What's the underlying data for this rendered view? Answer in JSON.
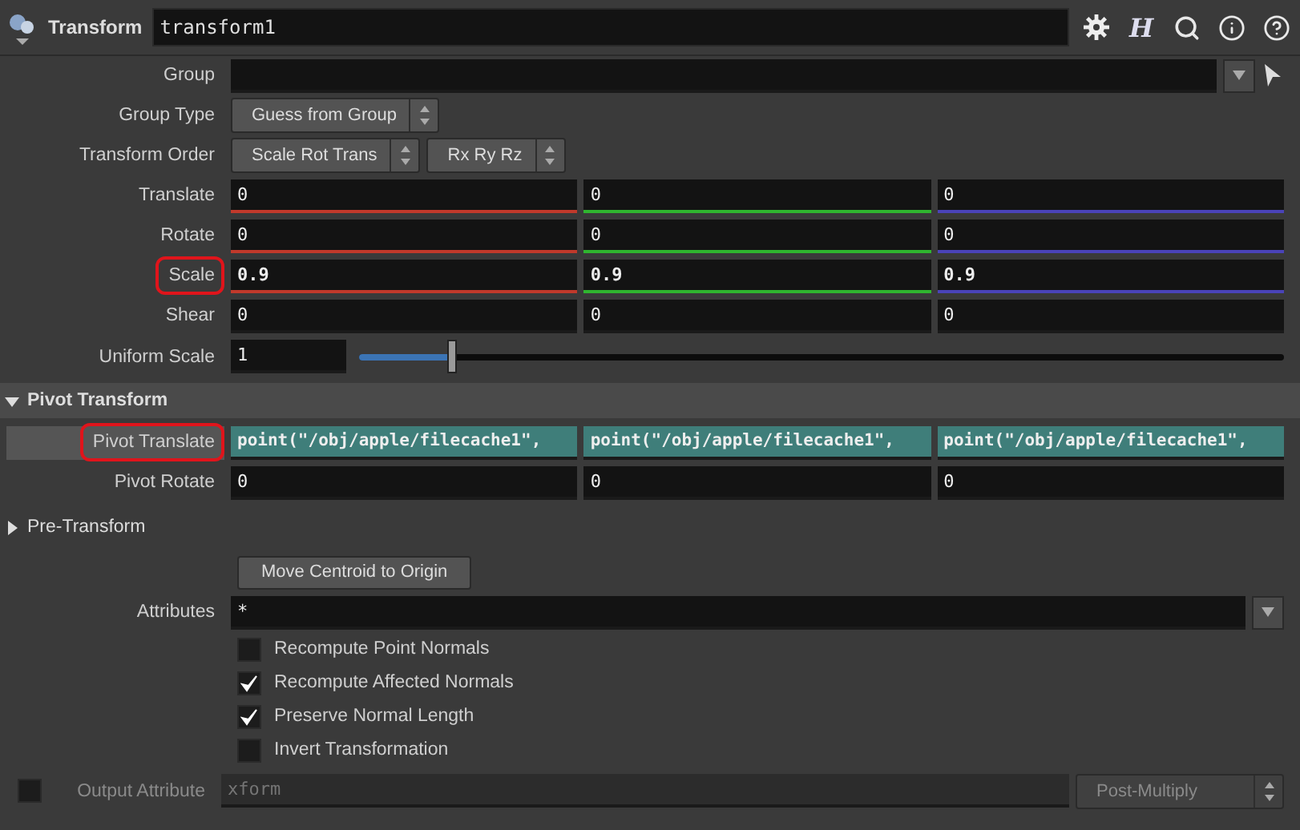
{
  "header": {
    "node_type": "Transform",
    "node_name": "transform1",
    "tools": [
      {
        "kind": "gear"
      },
      {
        "kind": "text",
        "label": "H"
      },
      {
        "kind": "search"
      },
      {
        "kind": "info"
      },
      {
        "kind": "help"
      }
    ]
  },
  "params": [
    {
      "kind": "string",
      "label": "Group",
      "circled": false,
      "hovered": false
    },
    {
      "kind": "menu",
      "label": "Group Type",
      "menus": [
        "Guess from Group"
      ],
      "circled": false,
      "hovered": false
    },
    {
      "kind": "menu",
      "label": "Transform Order",
      "menus": [
        "Scale Rot Trans",
        "Rx Ry Rz"
      ],
      "circled": false,
      "hovered": false
    },
    {
      "kind": "vector",
      "label": "Translate",
      "values": [
        "0",
        "0",
        "0"
      ],
      "modified": false,
      "expression": false,
      "underline": true,
      "circled": false,
      "hovered": false
    },
    {
      "kind": "vector",
      "label": "Rotate",
      "values": [
        "0",
        "0",
        "0"
      ],
      "modified": false,
      "expression": false,
      "underline": true,
      "circled": false,
      "hovered": false
    },
    {
      "kind": "vector",
      "label": "Scale",
      "values": [
        "0.9",
        "0.9",
        "0.9"
      ],
      "modified": true,
      "expression": false,
      "underline": true,
      "circled": true,
      "hovered": false
    },
    {
      "kind": "vector",
      "label": "Shear",
      "values": [
        "0",
        "0",
        "0"
      ],
      "modified": false,
      "expression": false,
      "underline": false,
      "circled": false,
      "hovered": false
    },
    {
      "kind": "slider",
      "label": "Uniform Scale",
      "value": "1",
      "level": 0.1,
      "circled": false,
      "hovered": false
    },
    {
      "kind": "section",
      "label": "Pivot Transform",
      "expanded": true
    },
    {
      "kind": "vector",
      "label": "Pivot Translate",
      "values": [
        "point(\"/obj/apple/filecache1\",",
        "point(\"/obj/apple/filecache1\",",
        "point(\"/obj/apple/filecache1\","
      ],
      "modified": true,
      "expression": true,
      "underline": false,
      "circled": true,
      "hovered": true
    },
    {
      "kind": "vector",
      "label": "Pivot Rotate",
      "values": [
        "0",
        "0",
        "0"
      ],
      "modified": false,
      "expression": false,
      "underline": false,
      "circled": false,
      "hovered": false
    },
    {
      "kind": "section",
      "label": "Pre-Transform",
      "expanded": false
    },
    {
      "kind": "button",
      "label": "Move Centroid to Origin"
    },
    {
      "kind": "string",
      "label": "Attributes",
      "value": "*",
      "circled": false,
      "hovered": false
    },
    {
      "kind": "checkbox",
      "label": "Recompute Point Normals",
      "checked": false
    },
    {
      "kind": "checkbox",
      "label": "Recompute Affected Normals",
      "checked": true
    },
    {
      "kind": "checkbox",
      "label": "Preserve Normal Length",
      "checked": true
    },
    {
      "kind": "checkbox",
      "label": "Invert Transformation",
      "checked": false
    },
    {
      "kind": "output",
      "label": "Output Attribute",
      "enabled": false,
      "placeholder": "xform",
      "menu": "Post-Multiply"
    }
  ]
}
